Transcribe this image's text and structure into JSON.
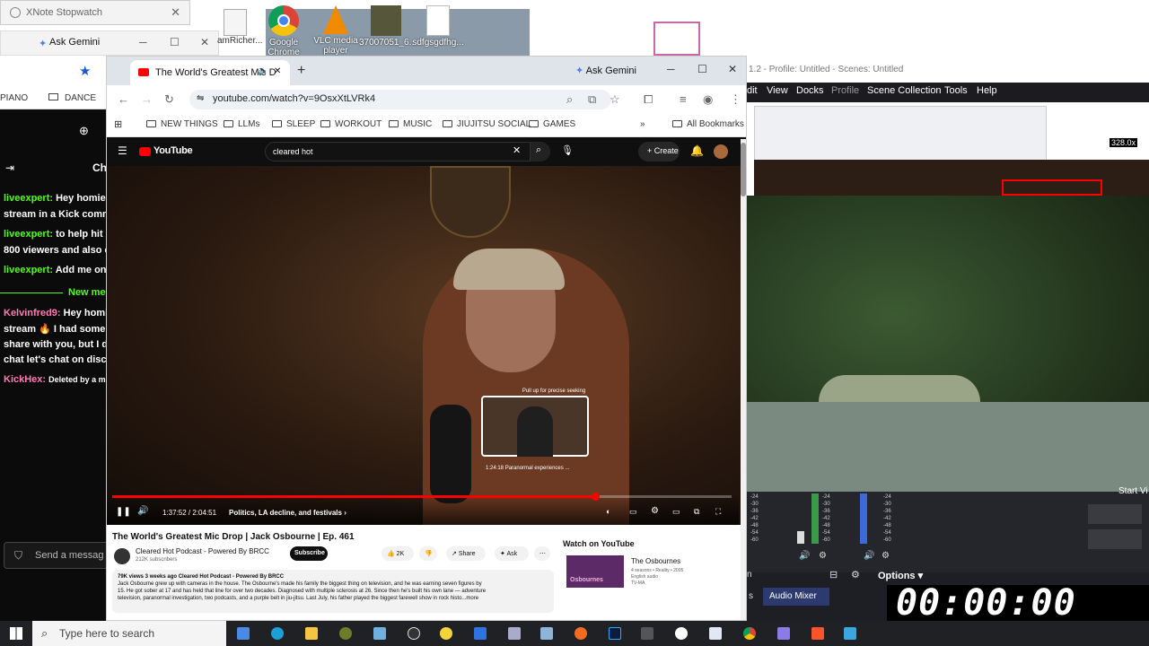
{
  "desktop": {
    "xnote_title": "XNote Stopwatch",
    "gemini_label": "Ask Gemini",
    "icons": [
      {
        "label": "Google Chrome"
      },
      {
        "label": "VLC media player"
      },
      {
        "label": "37007051_6..."
      },
      {
        "label": "sdfgsgdfhg..."
      }
    ],
    "partial_icon_label": "amRicher..."
  },
  "chat": {
    "bookmarks": [
      "PIANO",
      "DANCE"
    ],
    "header_fragment": "Ch",
    "lines": [
      {
        "user": "liveexpert:",
        "text": "Hey homie,"
      },
      {
        "user": "",
        "text": "stream in a Kick comm"
      },
      {
        "user": "liveexpert:",
        "text": "to help hit 1"
      },
      {
        "user": "",
        "text": "800 viewers and also e"
      },
      {
        "user": "liveexpert:",
        "text": "Add me on"
      },
      {
        "user": "",
        "text": "New me"
      },
      {
        "user": "Kelvinfred9:",
        "text": "Hey homi"
      },
      {
        "user": "",
        "text": "stream 🔥 I had some s"
      },
      {
        "user": "",
        "text": "share with you, but I do"
      },
      {
        "user": "",
        "text": "chat let's chat on disco"
      },
      {
        "user": "KickHex:",
        "text": "Deleted by a m"
      }
    ],
    "send_placeholder": "Send a messag"
  },
  "browser": {
    "tab_title": "The World's Greatest Mic D",
    "ask_gemini": "Ask Gemini",
    "url": "youtube.com/watch?v=9OsxXtLVRk4",
    "bookmarks": [
      "NEW THINGS",
      "LLMs",
      "SLEEP",
      "WORKOUT",
      "MUSIC",
      "JIUJITSU SOCIAL",
      "GAMES"
    ],
    "all_bookmarks": "All Bookmarks"
  },
  "youtube": {
    "logo": "YouTube",
    "search_value": "cleared hot",
    "create_label": "Create",
    "seek_hint": "Pull up for precise seeking",
    "preview_time": "1:24:18",
    "preview_chapter": "Paranormal experiences ...",
    "time_current": "1:37:52",
    "time_total": "2:04:51",
    "chapter": "Politics, LA decline, and festivals",
    "progress": 0.78,
    "video_title": "The World's Greatest Mic Drop | Jack Osbourne | Ep. 461",
    "channel": "Cleared Hot Podcast - Powered By BRCC",
    "subscribers": "212K subscribers",
    "subscribe": "Subscribe",
    "likes": "2K",
    "share": "Share",
    "ask": "Ask",
    "desc_stats": "79K views  3 weeks ago  Cleared Hot Podcast - Powered By BRCC",
    "desc_l1": "Jack Osbourne grew up with cameras in the house. The Osbourne's made his family the biggest thing on television, and he was earning seven figures by",
    "desc_l2": "15. He got sober at 17 and has held that line for over two decades. Diagnosed with multiple sclerosis at 26. Since then he's built his own lane — adventure",
    "desc_l3": "television, paranormal investigation, two podcasts, and a purple belt in jiu-jitsu. Last July, his father played the biggest farewell show in rock histo...more",
    "watch_on": "Watch on YouTube",
    "rec_title": "The Osbournes",
    "rec_sub1": "4 seasons • Reality • 2005",
    "rec_sub2": "English audio",
    "rec_sub3": "TV-MA",
    "rec_badge": "Osbournes"
  },
  "obs": {
    "title": "1.2 - Profile: Untitled - Scenes: Untitled",
    "menu": [
      "dit",
      "View",
      "Docks",
      "Profile",
      "Scene Collection",
      "Tools",
      "Help"
    ],
    "start_fragment": "Start Vi",
    "options": "Options",
    "s_fragment": "s",
    "audio_mixer": "Audio Mixer",
    "meter_ticks": [
      "-24",
      "-30",
      "-36",
      "-42",
      "-48",
      "-54",
      "-60"
    ],
    "overlay_text": "328.0x"
  },
  "timer": "00:00:00",
  "taskbar": {
    "search_placeholder": "Type here to search"
  }
}
